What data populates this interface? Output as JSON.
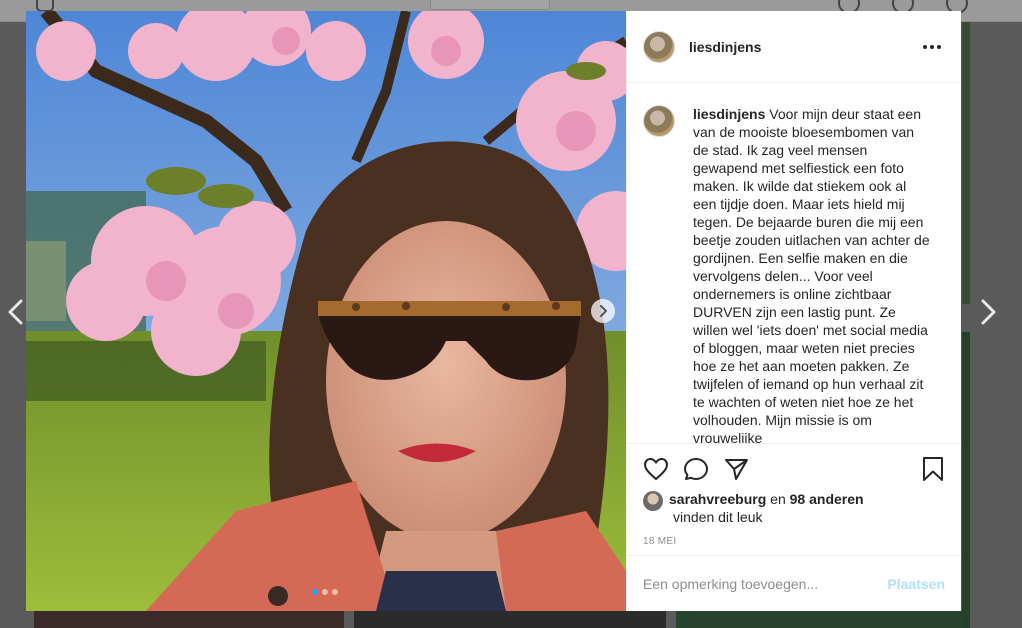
{
  "post": {
    "username": "liesdinjens",
    "caption_user": "liesdinjens",
    "caption_text": "Voor mijn deur staat een van de mooiste bloesembomen van de stad. Ik zag veel mensen gewapend met selfiestick een foto maken. Ik wilde dat stiekem ook al een tijdje doen. Maar iets hield mij tegen. De bejaarde buren die mij een beetje zouden uitlachen van achter de gordijnen. Een selfie maken en die vervolgens delen... Voor veel ondernemers is online zichtbaar DURVEN zijn een lastig punt. Ze willen wel 'iets doen' met social media of bloggen, maar weten niet precies hoe ze het aan moeten pakken. Ze twijfelen of iemand op hun verhaal zit te wachten of weten niet hoe ze het volhouden. Mijn missie is om vrouwelijke",
    "likes": {
      "liker": "sarahvreeburg",
      "connector": "en",
      "others": "98 anderen",
      "suffix": "vinden dit leuk"
    },
    "date": "18 MEI",
    "comment_placeholder": "Een opmerking toevoegen...",
    "post_button": "Plaatsen",
    "carousel": {
      "slide_count": 3,
      "active_index": 0
    }
  },
  "icons": {
    "header_more": "more-dots-icon",
    "like": "heart-icon",
    "comment": "comment-bubble-icon",
    "share": "paper-plane-icon",
    "save": "bookmark-icon",
    "prev": "chevron-left-icon",
    "next": "chevron-right-icon"
  },
  "colors": {
    "text": "#262626",
    "muted": "#8e8e8e",
    "post_button_disabled": "#b2dffc",
    "dot_active": "#3897f0"
  }
}
